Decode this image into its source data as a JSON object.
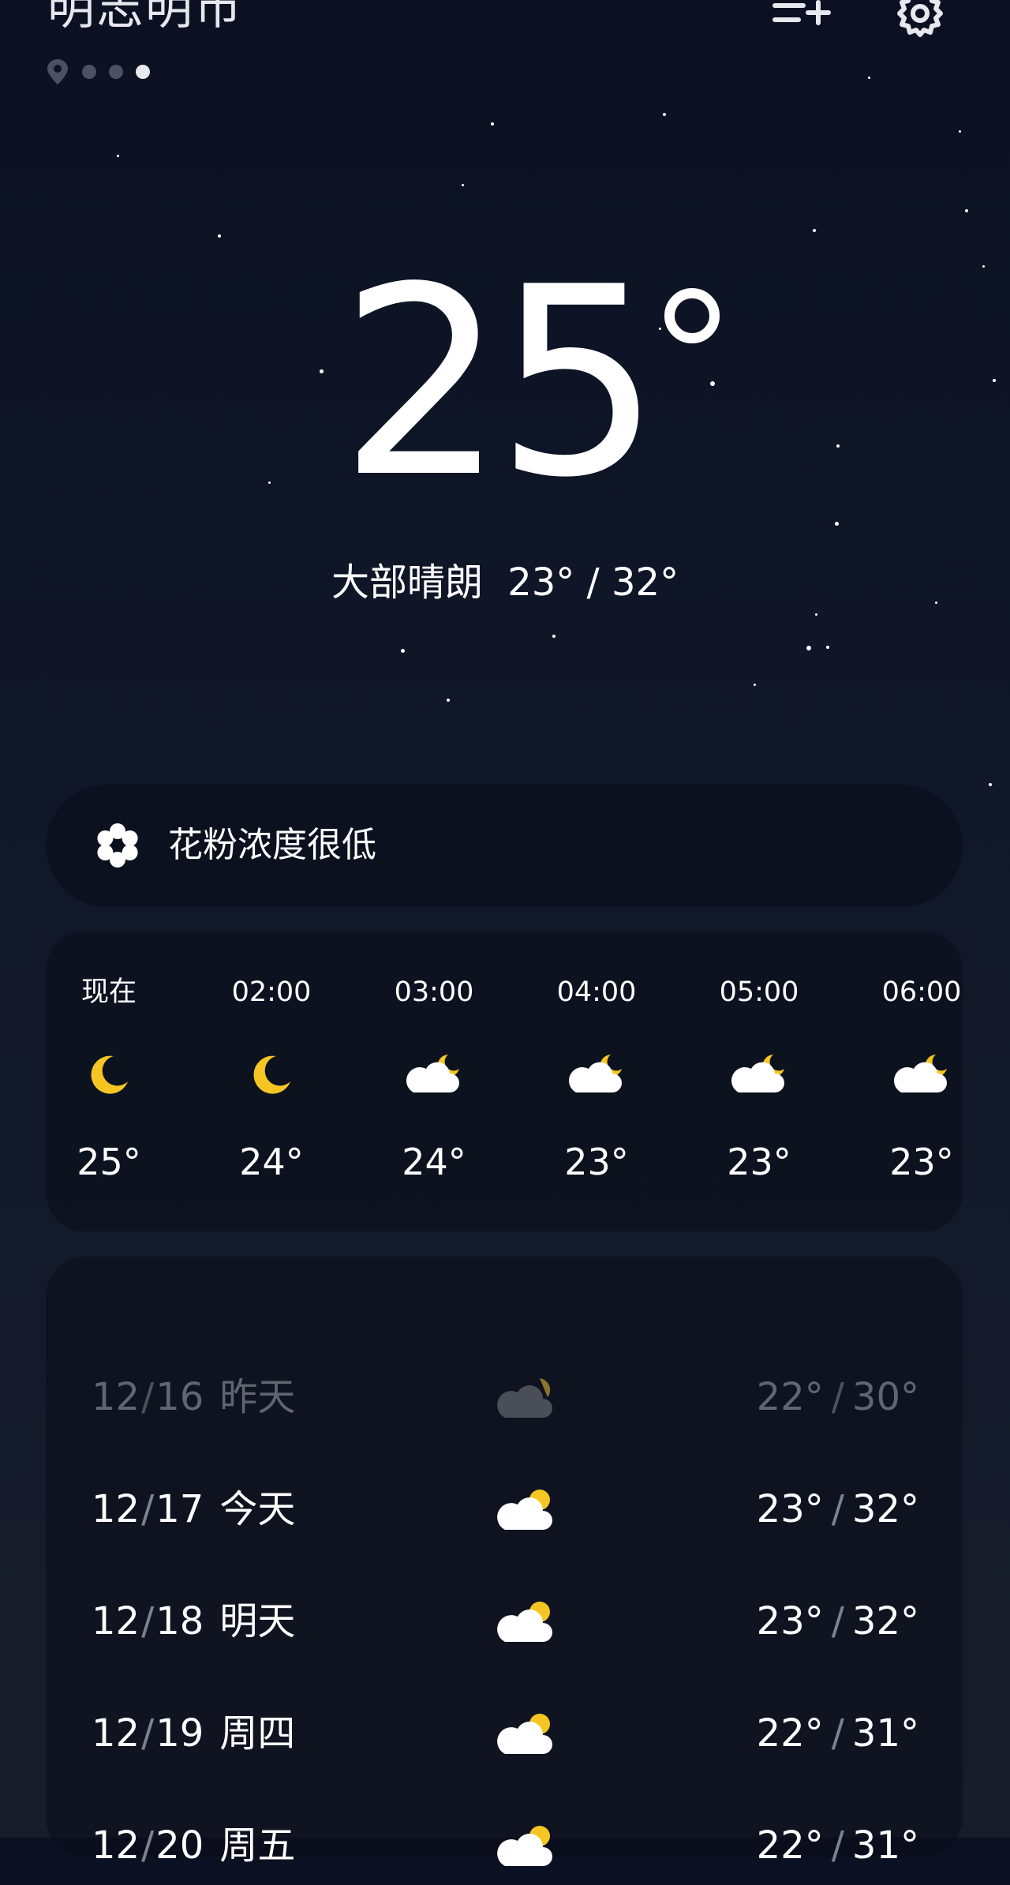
{
  "header": {
    "city": "明志明市",
    "location_icon": "location-pin-icon",
    "page_dots": 3,
    "active_dot": 2,
    "add_city_icon": "add-city-icon",
    "settings_icon": "settings-gear-icon"
  },
  "current": {
    "temperature": "25",
    "condition": "大部晴朗",
    "range": "23° / 32°"
  },
  "pollen": {
    "icon": "flower-icon",
    "text": "花粉浓度很低"
  },
  "hourly": [
    {
      "time": "现在",
      "icon": "moon-icon",
      "temp": "25°"
    },
    {
      "time": "02:00",
      "icon": "moon-icon",
      "temp": "24°"
    },
    {
      "time": "03:00",
      "icon": "cloud-moon-icon",
      "temp": "24°"
    },
    {
      "time": "04:00",
      "icon": "cloud-moon-icon",
      "temp": "23°"
    },
    {
      "time": "05:00",
      "icon": "cloud-moon-icon",
      "temp": "23°"
    },
    {
      "time": "06:00",
      "icon": "cloud-moon-icon",
      "temp": "23°"
    }
  ],
  "daily": [
    {
      "month": "12",
      "day": "16",
      "name": "昨天",
      "icon": "partly-cloudy-icon",
      "low": "22°",
      "high": "30°"
    },
    {
      "month": "12",
      "day": "17",
      "name": "今天",
      "icon": "partly-cloudy-icon",
      "low": "23°",
      "high": "32°"
    },
    {
      "month": "12",
      "day": "18",
      "name": "明天",
      "icon": "partly-cloudy-icon",
      "low": "23°",
      "high": "32°"
    },
    {
      "month": "12",
      "day": "19",
      "name": "周四",
      "icon": "partly-cloudy-icon",
      "low": "22°",
      "high": "31°"
    },
    {
      "month": "12",
      "day": "20",
      "name": "周五",
      "icon": "partly-cloudy-icon",
      "low": "22°",
      "high": "31°"
    }
  ],
  "colors": {
    "background": "#0f1627",
    "sun_yellow": "#f5c623",
    "dimmed_text": "#60656f"
  }
}
